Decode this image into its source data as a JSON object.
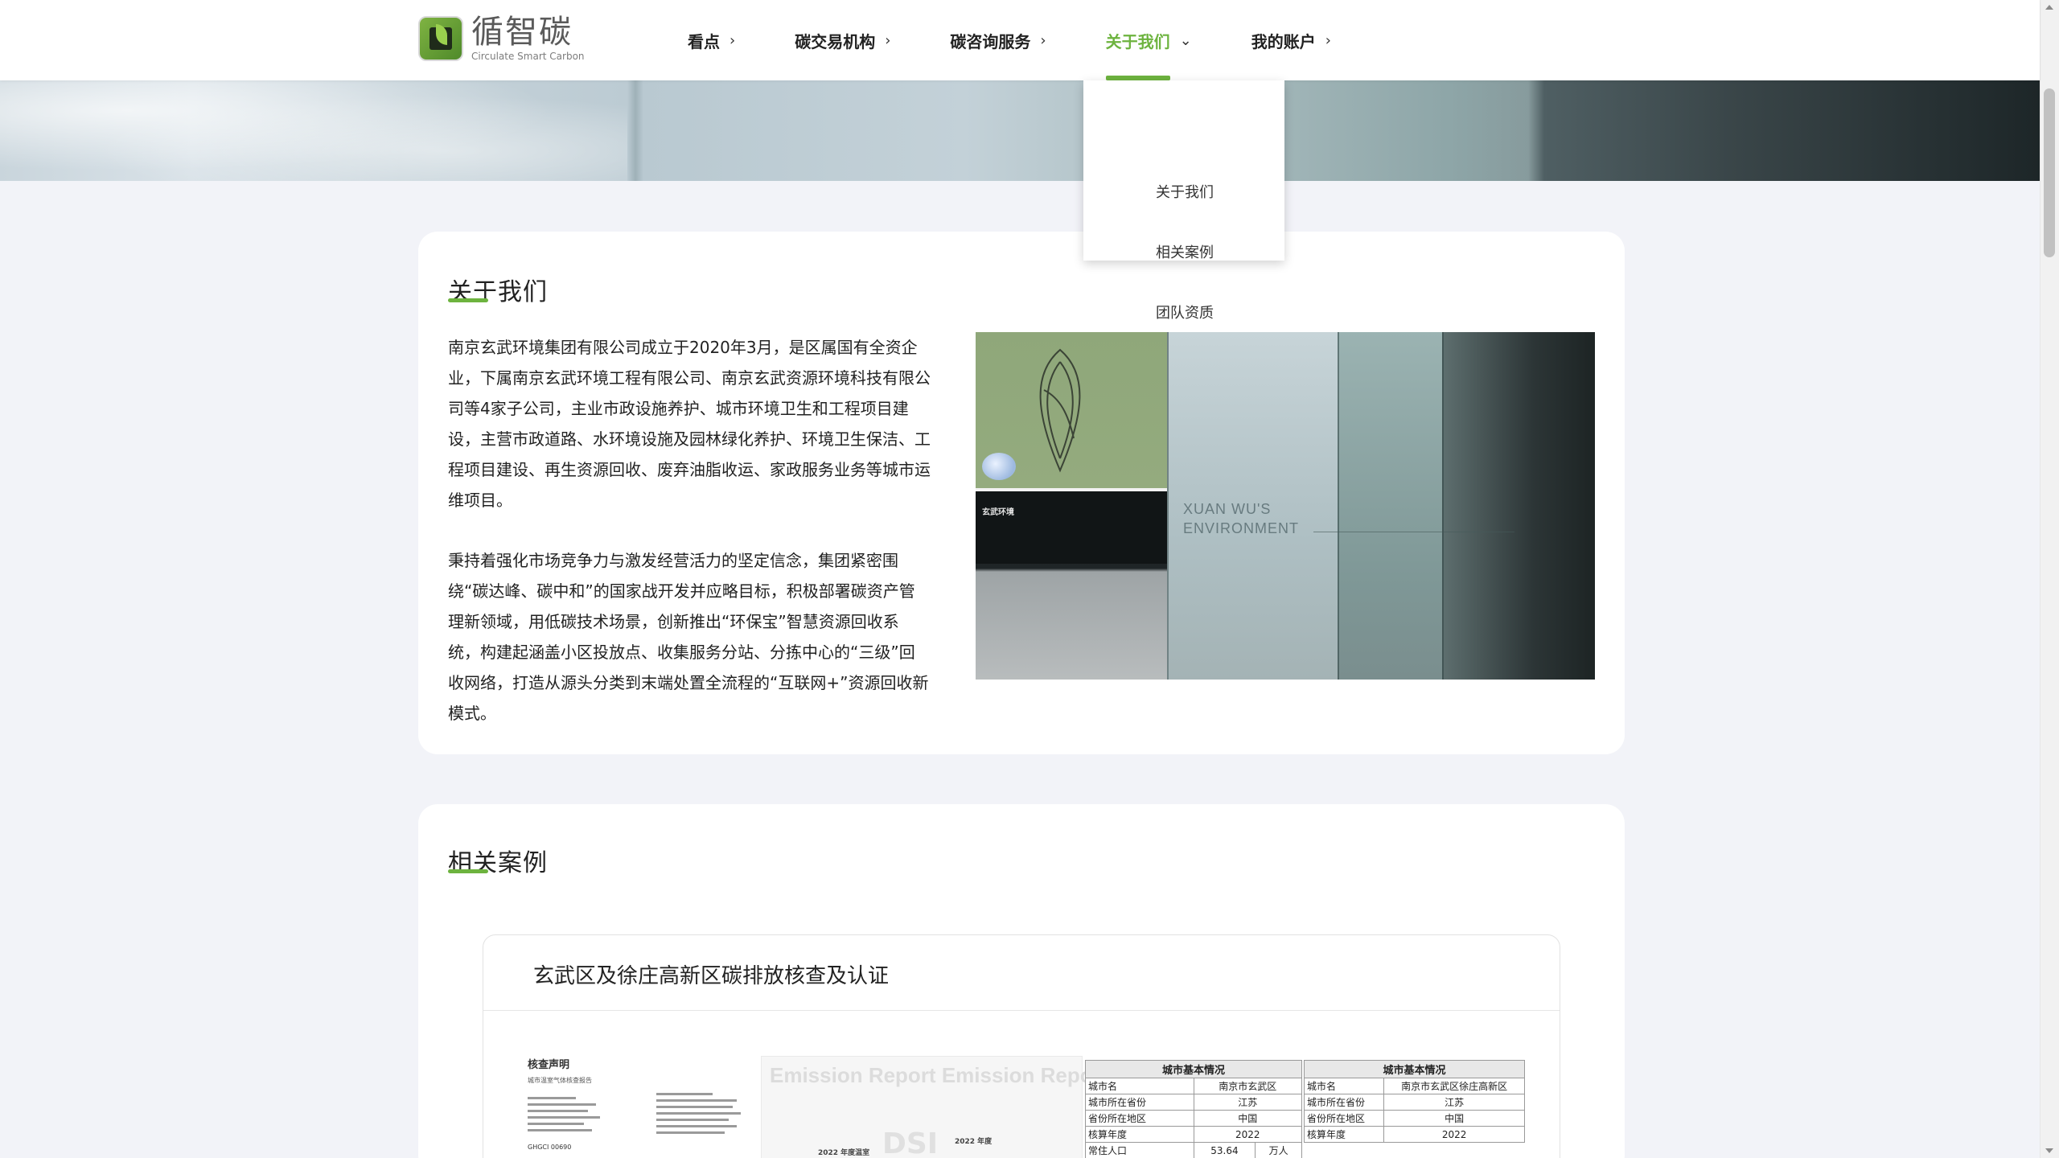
{
  "brand": {
    "name": "循智碳",
    "tagline": "Circulate Smart Carbon"
  },
  "nav": [
    {
      "label": "看点",
      "chevron": "›"
    },
    {
      "label": "碳交易机构",
      "chevron": "›"
    },
    {
      "label": "碳咨询服务",
      "chevron": "›"
    },
    {
      "label": "关于我们",
      "chevron": "⌄",
      "active": true
    },
    {
      "label": "我的账户",
      "chevron": "›"
    }
  ],
  "dropdown": [
    {
      "label": "关于我们"
    },
    {
      "label": "相关案例"
    },
    {
      "label": "团队资质"
    }
  ],
  "about": {
    "title": "关于我们",
    "paragraphs": [
      "南京玄武环境集团有限公司成立于2020年3月，是区属国有全资企业，下属南京玄武环境工程有限公司、南京玄武资源环境科技有限公司等4家子公司，主业市政设施养护、城市环境卫生和工程项目建设，主营市政道路、水环境设施及园林绿化养护、环境卫生保洁、工程项目建设、再生资源回收、废弃油脂收运、家政服务业务等城市运维项目。",
      "秉持着强化市场竞争力与激发经营活力的坚定信念，集团紧密围绕“碳达峰、碳中和”的国家战开发并应略目标，积极部署碳资产管理新领域，用低碳技术场景，创新推出“环保宝”智慧资源回收系统，构建起涵盖小区投放点、收集服务分站、分拣中心的“三级”回收网络，打造从源头分类到末端处置全流程的“互联网+”资源回收新模式。"
    ],
    "photo_caption_line1": "XUAN WU'S",
    "photo_caption_line2": "ENVIRONMENT",
    "photo_sign": "玄武环境"
  },
  "cases": {
    "title": "相关案例",
    "case_title": "玄武区及徐庄高新区碳排放核查及认证",
    "doc1": {
      "heading": "核查声明",
      "sub": "城市温室气体核查报告",
      "code": "GHGCI 00690"
    },
    "doc2": {
      "watermark": "Emission Report  Emission Report",
      "year_label": "2022 年度",
      "left_label": "2022 年度温室",
      "logo": "DSI"
    },
    "table1": {
      "header": "城市基本情况",
      "rows": [
        {
          "k": "城市名",
          "v": "南京市玄武区"
        },
        {
          "k": "城市所在省份",
          "v": "江苏"
        },
        {
          "k": "省份所在地区",
          "v": "中国"
        },
        {
          "k": "核算年度",
          "v": "2022"
        },
        {
          "k": "常住人口",
          "v": "53.64",
          "unit": "万人"
        }
      ]
    },
    "table2": {
      "header": "城市基本情况",
      "rows": [
        {
          "k": "城市名",
          "v": "南京市玄武区徐庄高新区"
        },
        {
          "k": "城市所在省份",
          "v": "江苏"
        },
        {
          "k": "省份所在地区",
          "v": "中国"
        },
        {
          "k": "核算年度",
          "v": "2022"
        }
      ]
    }
  },
  "colors": {
    "accent": "#6db33f",
    "background": "#f2f3f8",
    "card": "#ffffff"
  }
}
